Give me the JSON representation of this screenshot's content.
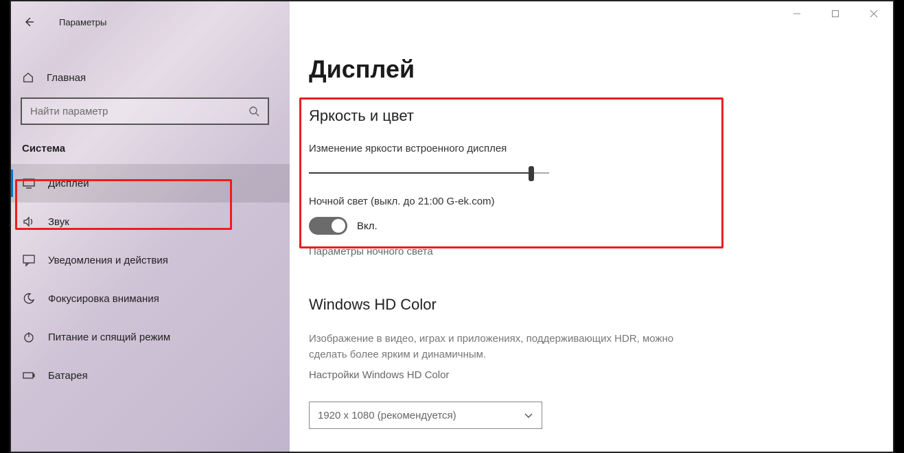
{
  "header": {
    "app_title": "Параметры"
  },
  "sidebar": {
    "home_label": "Главная",
    "search_placeholder": "Найти параметр",
    "group_label": "Система",
    "items": [
      {
        "id": "display",
        "label": "Дисплей",
        "selected": true
      },
      {
        "id": "sound",
        "label": "Звук",
        "selected": false
      },
      {
        "id": "notifications",
        "label": "Уведомления и действия",
        "selected": false
      },
      {
        "id": "focus",
        "label": "Фокусировка внимания",
        "selected": false
      },
      {
        "id": "power",
        "label": "Питание и спящий режим",
        "selected": false
      },
      {
        "id": "battery",
        "label": "Батарея",
        "selected": false
      }
    ]
  },
  "main": {
    "page_title": "Дисплей",
    "brightness": {
      "section_title": "Яркость и цвет",
      "slider_label": "Изменение яркости встроенного дисплея",
      "night_light_label": "Ночной свет (выкл. до 21:00 G-ek.com)",
      "toggle_state_label": "Вкл.",
      "night_light_settings_link": "Параметры ночного света"
    },
    "hd": {
      "section_title": "Windows HD Color",
      "description": "Изображение в видео, играх и приложениях, поддерживающих HDR, можно сделать более ярким и динамичным.",
      "settings_link": "Настройки Windows HD Color"
    },
    "resolution_dropdown_value": "1920 x 1080 (рекомендуется)"
  }
}
